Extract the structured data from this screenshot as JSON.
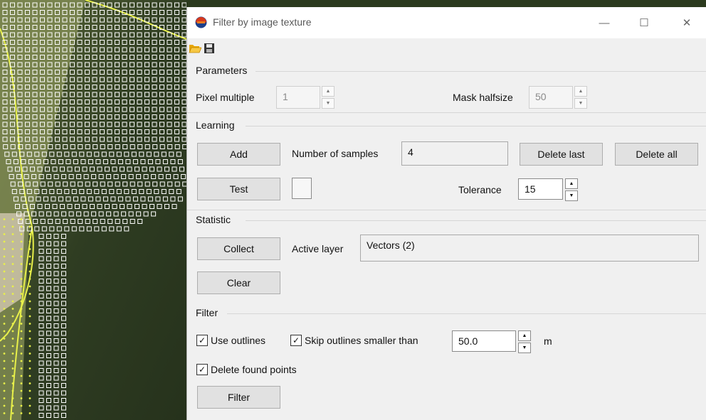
{
  "window": {
    "title": "Filter by image texture",
    "minimize_glyph": "—",
    "maximize_glyph": "☐",
    "close_glyph": "✕"
  },
  "toolbar": {
    "open_icon": "folder-open-icon",
    "save_icon": "floppy-save-icon"
  },
  "parameters": {
    "section_label": "Parameters",
    "pixel_multiple_label": "Pixel multiple",
    "pixel_multiple_value": "1",
    "mask_halfsize_label": "Mask halfsize",
    "mask_halfsize_value": "50"
  },
  "learning": {
    "section_label": "Learning",
    "add_label": "Add",
    "samples_label": "Number of samples",
    "samples_value": "4",
    "delete_last_label": "Delete last",
    "delete_all_label": "Delete all",
    "test_label": "Test",
    "tolerance_label": "Tolerance",
    "tolerance_value": "15"
  },
  "statistic": {
    "section_label": "Statistic",
    "collect_label": "Collect",
    "active_layer_label": "Active layer",
    "active_layer_value": "Vectors (2)",
    "clear_label": "Clear"
  },
  "filter": {
    "section_label": "Filter",
    "use_outlines_label": "Use outlines",
    "use_outlines_checked": true,
    "skip_outlines_label": "Skip outlines smaller than",
    "skip_outlines_checked": true,
    "skip_value": "50.0",
    "unit": "m",
    "delete_found_label": "Delete found points",
    "delete_found_checked": true,
    "filter_button_label": "Filter",
    "check_glyph": "✓"
  },
  "colors": {
    "accent_yellow": "#e8f04a",
    "dialog_bg": "#f0f0f0",
    "button_bg": "#e1e1e1"
  }
}
